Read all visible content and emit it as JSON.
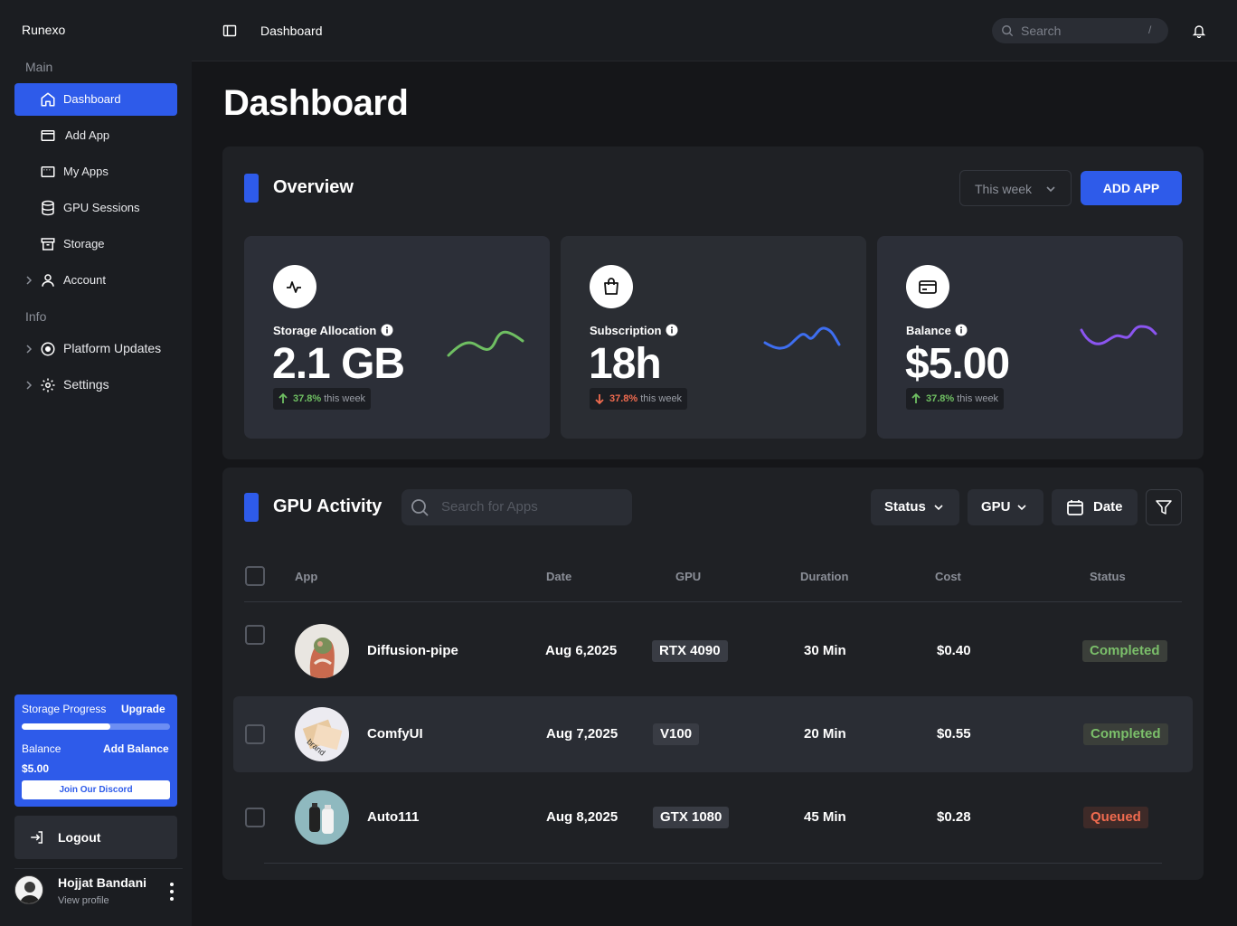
{
  "app": {
    "brand": "Runexo"
  },
  "sidebar": {
    "section_main": "Main",
    "section_info": "Info",
    "items": [
      {
        "label": "Dashboard",
        "icon": "home-icon"
      },
      {
        "label": "Add App",
        "icon": "window-icon"
      },
      {
        "label": "My Apps",
        "icon": "apps-icon"
      },
      {
        "label": "GPU Sessions",
        "icon": "database-icon"
      },
      {
        "label": "Storage",
        "icon": "archive-icon"
      },
      {
        "label": "Account",
        "icon": "user-icon"
      },
      {
        "label": "Platform Updates",
        "icon": "circle-icon"
      },
      {
        "label": "Settings",
        "icon": "gear-icon"
      }
    ],
    "storage": {
      "title": "Storage Progress",
      "upgrade": "Upgrade",
      "progress": 0.6,
      "balance_label": "Balance",
      "add_balance": "Add Balance",
      "balance_value": "$5.00",
      "discord": "Join Our Discord"
    },
    "logout": "Logout",
    "profile": {
      "name": "Hojjat Bandani",
      "sub": "View profile"
    }
  },
  "topbar": {
    "breadcrumb": "Dashboard",
    "search_placeholder": "Search",
    "search_shortcut": "/"
  },
  "page": {
    "title": "Dashboard"
  },
  "overview": {
    "title": "Overview",
    "period": "This week",
    "add_app": "ADD APP",
    "cards": [
      {
        "label": "Storage Allocation",
        "value": "2.1 GB",
        "change": "37.8%",
        "direction": "up",
        "period": "this week",
        "spark_color": "#6fbf62",
        "bg": "#2c2f38"
      },
      {
        "label": "Subscription",
        "value": "18h",
        "change": "37.8%",
        "direction": "down",
        "period": "this week",
        "spark_color": "#3e6ef0",
        "bg": "#2a2d33"
      },
      {
        "label": "Balance",
        "value": "$5.00",
        "change": "37.8%",
        "direction": "up",
        "period": "this week",
        "spark_color": "#8b55f0",
        "bg": "#2c2f38"
      }
    ]
  },
  "gpu_activity": {
    "title": "GPU Activity",
    "search_placeholder": "Search for Apps",
    "filters": {
      "status": "Status",
      "gpu": "GPU",
      "date": "Date"
    },
    "columns": [
      "App",
      "Date",
      "GPU",
      "Duration",
      "Cost",
      "Status"
    ],
    "rows": [
      {
        "app": "Diffusion-pipe",
        "date": "Aug 6,2025",
        "gpu": "RTX 4090",
        "duration": "30 Min",
        "cost": "$0.40",
        "status": "Completed"
      },
      {
        "app": "ComfyUI",
        "date": "Aug 7,2025",
        "gpu": "V100",
        "duration": "20 Min",
        "cost": "$0.55",
        "status": "Completed"
      },
      {
        "app": "Auto111",
        "date": "Aug 8,2025",
        "gpu": "GTX 1080",
        "duration": "45 Min",
        "cost": "$0.28",
        "status": "Queued"
      }
    ]
  }
}
